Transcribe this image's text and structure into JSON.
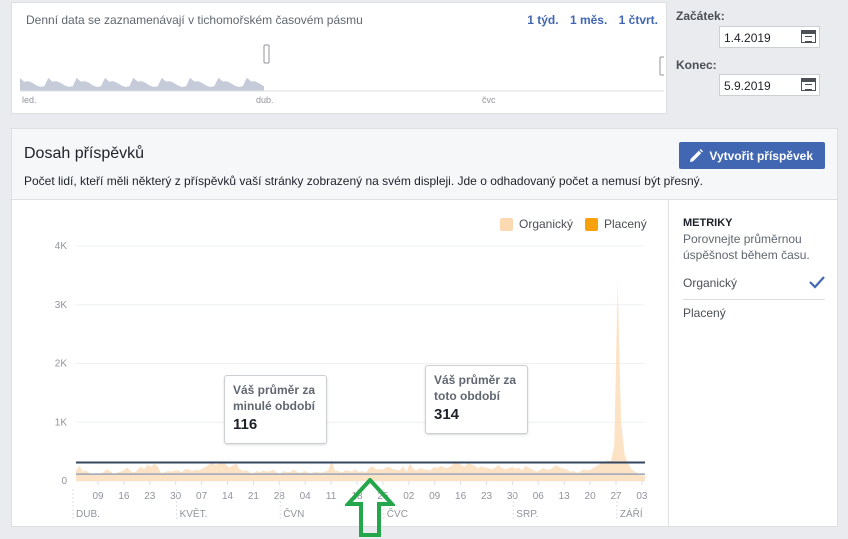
{
  "top": {
    "timezone_note": "Denní data se zaznamenávají v tichomořském časovém pásmu",
    "range_links": [
      "1 týd.",
      "1 měs.",
      "1 čtvrt."
    ],
    "mini_axis_labels": [
      "led.",
      "dub.",
      "čvc"
    ]
  },
  "dates": {
    "start_label": "Začátek:",
    "start_value": "1.4.2019",
    "end_label": "Konec:",
    "end_value": "5.9.2019"
  },
  "main": {
    "title": "Dosah příspěvků",
    "description": "Počet lidí, kteří měli některý z příspěvků vaší stránky zobrazený na svém displeji. Jde o odhadovaný počet a nemusí být přesný.",
    "create_button": "Vytvořit příspěvek"
  },
  "legend": {
    "organic": "Organický",
    "paid": "Placený"
  },
  "colors": {
    "organic": "#fcd9b1",
    "paid": "#f7a10d",
    "accent": "#4267b2",
    "avg_current": "#344561",
    "avg_previous": "#9aa5b8",
    "arrow": "#23a74a"
  },
  "metrics": {
    "title": "METRIKY",
    "description": "Porovnejte průměrnou úspěšnost během času.",
    "options": [
      {
        "label": "Organický",
        "selected": true
      },
      {
        "label": "Placený",
        "selected": false
      }
    ]
  },
  "tooltips": {
    "previous": {
      "label": "Váš průměr za minulé období",
      "value": "116"
    },
    "current": {
      "label": "Váš průměr za toto období",
      "value": "314"
    }
  },
  "chart_data": {
    "type": "area",
    "series": [
      {
        "name": "Organický",
        "values": [
          170,
          260,
          160,
          180,
          130,
          110,
          140,
          120,
          150,
          200,
          170,
          120,
          140,
          160,
          180,
          230,
          170,
          140,
          180,
          250,
          200,
          280,
          240,
          300,
          240,
          130,
          150,
          170,
          160,
          180,
          180,
          150,
          200,
          200,
          170,
          190,
          180,
          210,
          240,
          280,
          320,
          270,
          300,
          340,
          280,
          230,
          260,
          300,
          200,
          170,
          180,
          150,
          130,
          170,
          150,
          180,
          160,
          170,
          190,
          140,
          130,
          170,
          150,
          160,
          190,
          150,
          140,
          170,
          150,
          130,
          160,
          150,
          140,
          160,
          180,
          360,
          170,
          170,
          140,
          180,
          170,
          160,
          200,
          150,
          170,
          140,
          220,
          250,
          200,
          200,
          190,
          230,
          240,
          200,
          190,
          180,
          250,
          160,
          300,
          200,
          180,
          220,
          200,
          190,
          180,
          240,
          220,
          260,
          230,
          220,
          250,
          310,
          320,
          280,
          240,
          300,
          290,
          260,
          220,
          250,
          230,
          220,
          200,
          230,
          270,
          220,
          200,
          220,
          240,
          210,
          230,
          180,
          260,
          220,
          200,
          160,
          180,
          220,
          200,
          190,
          230,
          270,
          230,
          210,
          200,
          160,
          170,
          140,
          160,
          200,
          180,
          190,
          230,
          260,
          300,
          320,
          350,
          340,
          600,
          3400,
          1000,
          450,
          300,
          200,
          160,
          130,
          100,
          90
        ]
      },
      {
        "name": "Placený",
        "values": []
      }
    ],
    "y_ticks": [
      "4K",
      "3K",
      "2K",
      "1K",
      "0"
    ],
    "ylim": [
      0,
      4000
    ],
    "x_ticks": [
      "09",
      "16",
      "23",
      "30",
      "07",
      "14",
      "21",
      "28",
      "04",
      "11",
      "18",
      "25",
      "02",
      "09",
      "16",
      "23",
      "30",
      "06",
      "13",
      "20",
      "27",
      "03"
    ],
    "month_labels": [
      "DUB.",
      "KVĚT.",
      "ČVN",
      "ČVC",
      "SRP.",
      "ZÁŘÍ"
    ],
    "avg_previous": 116,
    "avg_current": 314,
    "legend_position": "top-right"
  }
}
